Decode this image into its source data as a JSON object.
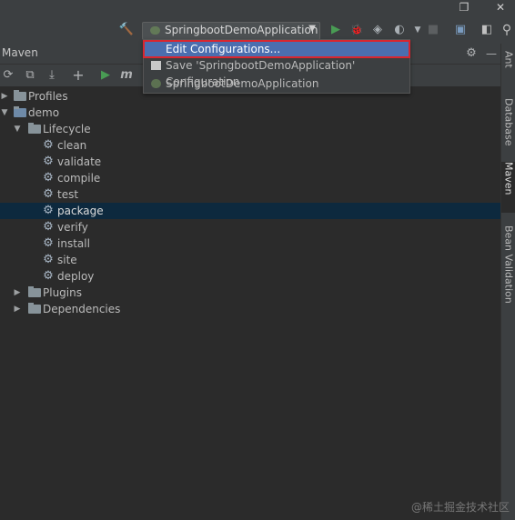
{
  "window_buttons": {
    "restore": "❐",
    "close": "✕"
  },
  "run_config": {
    "selected": "SpringbootDemoApplication"
  },
  "toolbar": {
    "hammer": "🔨",
    "run": "▶",
    "debug": "🐞",
    "coverage": "◈",
    "profile": "◐",
    "stop": "■",
    "project_structure": "▣",
    "layout": "◧",
    "search": "⚲"
  },
  "popup": {
    "items": [
      {
        "label": "Edit Configurations..."
      },
      {
        "label": "Save 'SpringbootDemoApplication' Configuration"
      },
      {
        "label": "SpringbootDemoApplication"
      }
    ]
  },
  "maven": {
    "title": "Maven",
    "settings": "⚙",
    "hide": "—",
    "tools": {
      "reload": "⟳",
      "add_folder": "⧉",
      "download": "⤓",
      "add": "+",
      "run": "▶",
      "m": "m",
      "tasks": "⇄"
    },
    "tree": {
      "profiles": "Profiles",
      "demo": "demo",
      "lifecycle": "Lifecycle",
      "phases": [
        "clean",
        "validate",
        "compile",
        "test",
        "package",
        "verify",
        "install",
        "site",
        "deploy"
      ],
      "plugins": "Plugins",
      "dependencies": "Dependencies"
    }
  },
  "right_tabs": [
    "Ant",
    "Database",
    "Maven",
    "Bean Validation"
  ],
  "watermark": "@稀土掘金技术社区",
  "colors": {
    "selection": "#0d293e",
    "popup_highlight": "#4b6eaf",
    "highlight_border": "#d9262f",
    "run_green": "#499c54"
  }
}
